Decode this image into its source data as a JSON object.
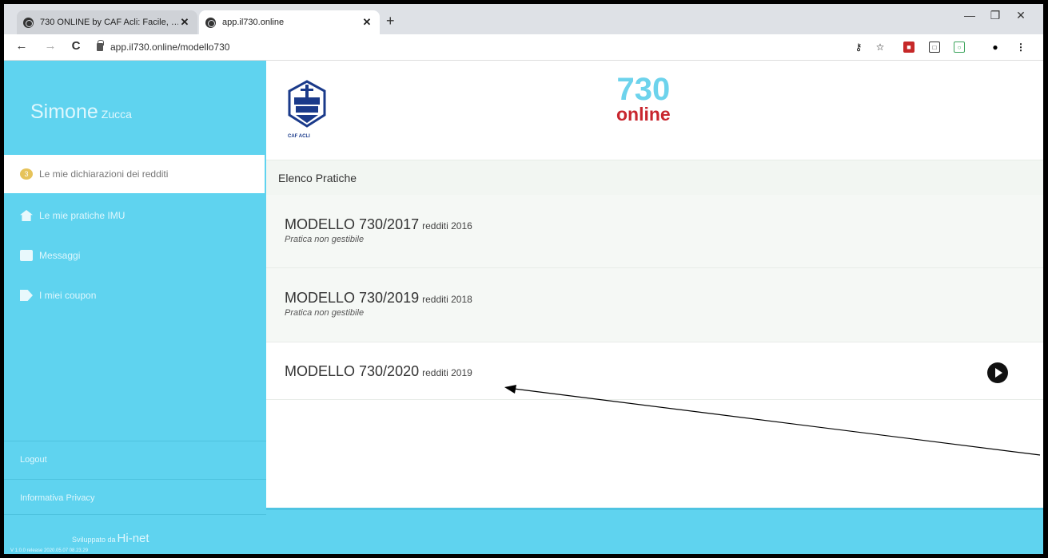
{
  "browser": {
    "tabs": [
      {
        "title": "730 ONLINE by CAF Acli: Facile, …",
        "close": "✕"
      },
      {
        "title": "app.il730.online",
        "close": "✕"
      }
    ],
    "new_tab": "+",
    "window_controls": {
      "minimize": "—",
      "restore": "❐",
      "close": "✕"
    },
    "nav": {
      "back": "←",
      "forward": "→",
      "reload": "C"
    },
    "url": "app.il730.online/modello730",
    "toolbar_icons": [
      "key-icon",
      "star-icon",
      "extension-red-icon",
      "extension-box-icon",
      "extension-green-icon",
      "profile-icon",
      "menu-icon"
    ]
  },
  "sidebar": {
    "user_first": "Simone",
    "user_last": "Zucca",
    "items": [
      {
        "label": "Le mie dichiarazioni dei redditi",
        "icon_text": "3"
      },
      {
        "label": "Le mie pratiche IMU"
      },
      {
        "label": "Messaggi",
        "icon_text": "…"
      },
      {
        "label": "I miei coupon"
      }
    ],
    "logout": "Logout",
    "privacy": "Informativa Privacy",
    "credit_prefix": "Sviluppato da",
    "credit_brand": "Hi-net",
    "version": "V 1.0.0 release 2020.05.07 08.23.29"
  },
  "header": {
    "logo_caption": "CAF ACLI",
    "brand_number": "730",
    "brand_word": "online"
  },
  "main": {
    "section_title": "Elenco Pratiche",
    "pratiche": [
      {
        "title": "MODELLO 730/2017",
        "redditi": "redditi 2016",
        "note": "Pratica non gestibile"
      },
      {
        "title": "MODELLO 730/2019",
        "redditi": "redditi 2018",
        "note": "Pratica non gestibile"
      },
      {
        "title": "MODELLO 730/2020",
        "redditi": "redditi 2019"
      }
    ]
  },
  "colors": {
    "sidebar": "#5fd3ef",
    "brand_blue": "#6dd3ec",
    "brand_red": "#c8262e"
  }
}
